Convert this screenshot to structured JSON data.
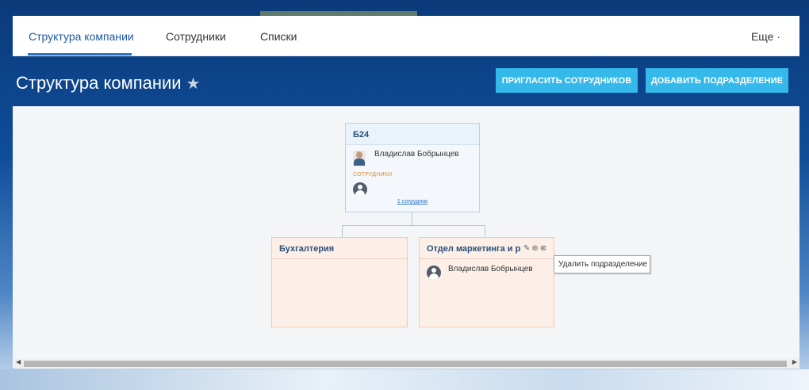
{
  "nav": {
    "tabs": [
      {
        "label": "Структура компании",
        "active": true
      },
      {
        "label": "Сотрудники"
      },
      {
        "label": "Списки"
      }
    ],
    "more_label": "Еще ·"
  },
  "header": {
    "title": "Структура компании",
    "star_icon": "star-icon",
    "invite_button": "ПРИГЛАСИТЬ СОТРУДНИКОВ",
    "add_department_button": "ДОБАВИТЬ ПОДРАЗДЕЛЕНИЕ"
  },
  "structure": {
    "root": {
      "name": "Б24",
      "head": "Владислав Бобрынцев",
      "employees_label": "СОТРУДНИКИ",
      "employees_link": "1 сотрудник"
    },
    "departments": [
      {
        "name": "Бухгалтерия"
      },
      {
        "name": "Отдел маркетинга и реклам",
        "head": "Владислав Бобрынцев"
      }
    ]
  },
  "tooltip": {
    "text": "Удалить подразделение"
  },
  "colors": {
    "accent_button": "#35b9ea",
    "active_tab": "#1c5aa8",
    "department_bg": "#fbefe7",
    "root_bg": "#f4f8fc"
  }
}
